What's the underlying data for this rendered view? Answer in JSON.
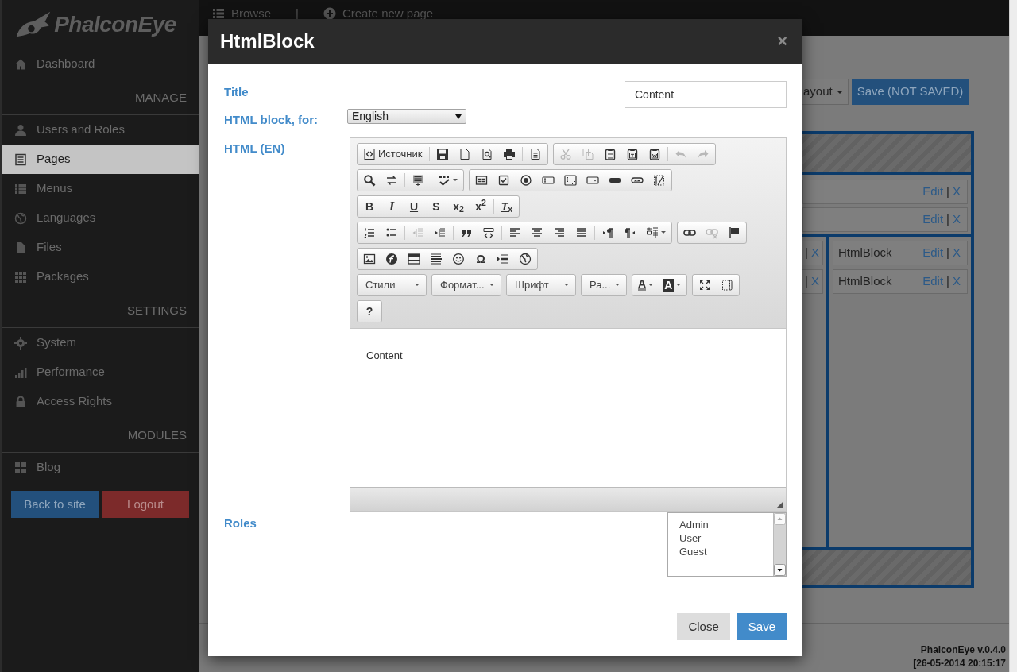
{
  "sidebar": {
    "logo": "PhalconEye",
    "items": [
      {
        "kind": "link",
        "label": "Dashboard",
        "selected": false
      },
      {
        "kind": "header",
        "label": "MANAGE"
      },
      {
        "kind": "link",
        "label": "Users and Roles",
        "selected": false
      },
      {
        "kind": "link",
        "label": "Pages",
        "selected": true
      },
      {
        "kind": "link",
        "label": "Menus",
        "selected": false
      },
      {
        "kind": "link",
        "label": "Languages",
        "selected": false
      },
      {
        "kind": "link",
        "label": "Files",
        "selected": false
      },
      {
        "kind": "link",
        "label": "Packages",
        "selected": false
      },
      {
        "kind": "header",
        "label": "SETTINGS"
      },
      {
        "kind": "link",
        "label": "System",
        "selected": false
      },
      {
        "kind": "link",
        "label": "Performance",
        "selected": false
      },
      {
        "kind": "link",
        "label": "Access Rights",
        "selected": false
      },
      {
        "kind": "header",
        "label": "MODULES"
      },
      {
        "kind": "link",
        "label": "Blog",
        "selected": false
      }
    ],
    "buttons": [
      {
        "label": "Back to site",
        "kind": "primary"
      },
      {
        "label": "Logout",
        "kind": "danger"
      }
    ]
  },
  "topbar": {
    "items": [
      {
        "kind": "link",
        "label": "Browse"
      },
      {
        "kind": "separator",
        "label": "|"
      },
      {
        "kind": "link",
        "label": "Create new page"
      }
    ]
  },
  "page": {
    "buttons": [
      {
        "label": "ayout",
        "kind": "default",
        "caret": true
      },
      {
        "label": "Save (NOT SAVED)",
        "kind": "primary",
        "caret": false
      }
    ],
    "layout": {
      "top_rows": [
        {
          "edit": "Edit",
          "separator": "|",
          "remove": "X"
        },
        {
          "edit": "Edit",
          "separator": "|",
          "remove": "X"
        }
      ],
      "left_rows": [
        {
          "separator": "|",
          "remove": "X"
        },
        {
          "separator": "|",
          "remove": "X"
        }
      ],
      "right_rows": [
        {
          "title": "HtmlBlock",
          "edit": "Edit",
          "separator": "|",
          "remove": "X"
        },
        {
          "title": "HtmlBlock",
          "edit": "Edit",
          "separator": "|",
          "remove": "X"
        }
      ]
    }
  },
  "footer": {
    "lines": [
      "PhalconEye v.0.4.0",
      "[26-05-2014 20:15:17"
    ]
  },
  "modal": {
    "title": "HtmlBlock",
    "close": "×",
    "fields": [
      {
        "kind": "text",
        "label": "Title",
        "value": "Content"
      },
      {
        "kind": "select",
        "label": "HTML block, for:",
        "value": "English"
      },
      {
        "kind": "editor",
        "label": "HTML (EN)",
        "content": "Content",
        "toolbar": [
          [
            [
              {
                "kind": "labeled",
                "label": "Источник",
                "disabled": false
              },
              {
                "kind": "separator"
              },
              {
                "kind": "icon",
                "disabled": false
              },
              {
                "kind": "icon",
                "disabled": false
              },
              {
                "kind": "icon",
                "disabled": false
              },
              {
                "kind": "icon",
                "disabled": false
              },
              {
                "kind": "separator"
              },
              {
                "kind": "icon",
                "disabled": false
              }
            ],
            [
              {
                "kind": "icon",
                "disabled": true
              },
              {
                "kind": "icon",
                "disabled": true
              },
              {
                "kind": "icon",
                "disabled": false
              },
              {
                "kind": "icon",
                "disabled": false
              },
              {
                "kind": "icon",
                "disabled": false
              },
              {
                "kind": "separator"
              },
              {
                "kind": "icon",
                "disabled": true
              },
              {
                "kind": "icon",
                "disabled": true
              }
            ]
          ],
          [
            [
              {
                "kind": "icon",
                "disabled": false
              },
              {
                "kind": "icon",
                "disabled": false
              },
              {
                "kind": "separator"
              },
              {
                "kind": "icon",
                "disabled": false
              },
              {
                "kind": "separator"
              },
              {
                "kind": "icon",
                "disabled": false,
                "caret": true
              }
            ],
            [
              {
                "kind": "icon",
                "disabled": false
              },
              {
                "kind": "icon",
                "disabled": false
              },
              {
                "kind": "icon",
                "disabled": false
              },
              {
                "kind": "icon",
                "disabled": false
              },
              {
                "kind": "icon",
                "disabled": false
              },
              {
                "kind": "icon",
                "disabled": false
              },
              {
                "kind": "icon",
                "disabled": false
              },
              {
                "kind": "icon",
                "disabled": false
              },
              {
                "kind": "icon",
                "disabled": false
              }
            ]
          ],
          [
            [
              {
                "kind": "bold",
                "label": "B",
                "disabled": false
              },
              {
                "kind": "italic",
                "label": "I",
                "disabled": false
              },
              {
                "kind": "underline",
                "label": "U",
                "disabled": false
              },
              {
                "kind": "strike",
                "label": "S",
                "disabled": false
              },
              {
                "kind": "bold",
                "label": "x$_{2}$",
                "disabled": false
              },
              {
                "kind": "bold",
                "label": "x$^{2}$",
                "disabled": false
              },
              {
                "kind": "separator"
              },
              {
                "kind": "underline",
                "label": "*T*$_{x}$",
                "disabled": false
              }
            ]
          ],
          [
            [
              {
                "kind": "icon",
                "disabled": false
              },
              {
                "kind": "icon",
                "disabled": false
              },
              {
                "kind": "separator"
              },
              {
                "kind": "icon",
                "disabled": true
              },
              {
                "kind": "icon",
                "disabled": false
              },
              {
                "kind": "separator"
              },
              {
                "kind": "icon",
                "disabled": false
              },
              {
                "kind": "icon",
                "disabled": false
              },
              {
                "kind": "separator"
              },
              {
                "kind": "icon",
                "disabled": false
              },
              {
                "kind": "icon",
                "disabled": false
              },
              {
                "kind": "icon",
                "disabled": false
              },
              {
                "kind": "icon",
                "disabled": false
              },
              {
                "kind": "separator"
              },
              {
                "kind": "icon",
                "disabled": false
              },
              {
                "kind": "icon",
                "disabled": false
              },
              {
                "kind": "icon",
                "disabled": false,
                "caret": true
              }
            ],
            [
              {
                "kind": "icon",
                "disabled": false
              },
              {
                "kind": "icon",
                "disabled": true
              },
              {
                "kind": "icon",
                "disabled": false
              }
            ]
          ],
          [
            [
              {
                "kind": "icon",
                "disabled": false
              },
              {
                "kind": "icon",
                "disabled": false
              },
              {
                "kind": "icon",
                "disabled": false
              },
              {
                "kind": "icon",
                "disabled": false
              },
              {
                "kind": "icon",
                "disabled": false
              },
              {
                "kind": "bold",
                "label": "Ω",
                "disabled": false
              },
              {
                "kind": "icon",
                "disabled": false
              },
              {
                "kind": "icon",
                "disabled": false
              }
            ]
          ],
          [
            [
              {
                "kind": "combo",
                "label": "Стили",
                "disabled": false
              }
            ],
            [
              {
                "kind": "combo",
                "label": "Формат...",
                "disabled": false
              }
            ],
            [
              {
                "kind": "combo",
                "label": "Шрифт",
                "disabled": false
              }
            ],
            [
              {
                "kind": "combo",
                "label": "Ра...",
                "disabled": false
              }
            ],
            [
              {
                "kind": "colorbar",
                "label": "A",
                "disabled": false,
                "caret": true
              },
              {
                "kind": "inverse",
                "label": "A",
                "disabled": false,
                "caret": true
              }
            ],
            [
              {
                "kind": "icon",
                "disabled": false
              },
              {
                "kind": "icon",
                "disabled": false
              }
            ]
          ],
          [
            [
              {
                "kind": "bold",
                "label": "?",
                "disabled": false
              }
            ]
          ]
        ]
      },
      {
        "kind": "listbox",
        "label": "Roles",
        "options": [
          "Admin",
          "User",
          "Guest"
        ]
      }
    ],
    "buttons": [
      {
        "label": "Close",
        "kind": "default"
      },
      {
        "label": "Save",
        "kind": "primary"
      }
    ]
  }
}
